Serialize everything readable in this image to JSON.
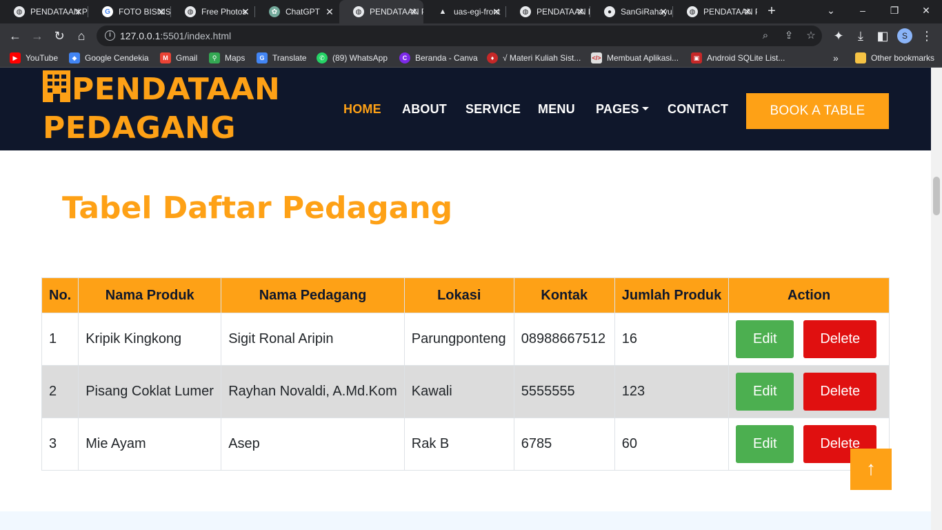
{
  "browser": {
    "tabs": [
      {
        "label": "PENDATAAN PEDAGANG",
        "icon": "globe-icon",
        "active": false
      },
      {
        "label": "FOTO BISNIS",
        "icon": "google-icon",
        "active": false
      },
      {
        "label": "Free Photos",
        "icon": "globe-icon",
        "active": false
      },
      {
        "label": "ChatGPT",
        "icon": "chatgpt-icon",
        "active": false
      },
      {
        "label": "PENDATAAN PEDAGANG",
        "icon": "globe-icon",
        "active": true
      },
      {
        "label": "uas-egi-front",
        "icon": "triangle-icon",
        "active": false
      },
      {
        "label": "PENDATAAN PEDAGANG",
        "icon": "globe-icon",
        "active": false
      },
      {
        "label": "SanGiRahayu",
        "icon": "github-icon",
        "active": false
      },
      {
        "label": "PENDATAAN PEDAGANG",
        "icon": "globe-icon",
        "active": false
      }
    ],
    "address": {
      "host": "127.0.0.1",
      "rest": ":5501/index.html"
    },
    "profile_initial": "S",
    "bookmarks": [
      {
        "label": "YouTube",
        "icon": "youtube-icon",
        "color": "#ff0000"
      },
      {
        "label": "Google Cendekia",
        "icon": "scholar-icon",
        "color": "#4285f4"
      },
      {
        "label": "Gmail",
        "icon": "gmail-icon",
        "color": "#ea4335"
      },
      {
        "label": "Maps",
        "icon": "maps-icon",
        "color": "#34a853"
      },
      {
        "label": "Translate",
        "icon": "translate-icon",
        "color": "#4285f4"
      },
      {
        "label": "(89) WhatsApp",
        "icon": "whatsapp-icon",
        "color": "#25d366"
      },
      {
        "label": "Beranda - Canva",
        "icon": "canva-icon",
        "color": "#7d2ae8"
      },
      {
        "label": "√ Materi Kuliah Sist...",
        "icon": "pin-icon",
        "color": "#c62828"
      },
      {
        "label": "Membuat Aplikasi...",
        "icon": "code-icon",
        "color": "#e0e0e0"
      },
      {
        "label": "Android SQLite List...",
        "icon": "android-icon",
        "color": "#c62828"
      }
    ],
    "overflow_label": "»",
    "other_bookmarks": "Other bookmarks"
  },
  "site": {
    "brand_line1": "PENDATAAN",
    "brand_line2": "PEDAGANG",
    "nav": [
      {
        "label": "HOME",
        "active": true
      },
      {
        "label": "ABOUT",
        "active": false
      },
      {
        "label": "SERVICE",
        "active": false
      },
      {
        "label": "MENU",
        "active": false
      },
      {
        "label": "PAGES",
        "active": false
      },
      {
        "label": "CONTACT",
        "active": false
      }
    ],
    "book_label": "BOOK A TABLE",
    "accent": "#fea116",
    "header_bg": "#0f172b"
  },
  "main": {
    "title": "Tabel Daftar Pedagang",
    "columns": [
      "No.",
      "Nama Produk",
      "Nama Pedagang",
      "Lokasi",
      "Kontak",
      "Jumlah Produk",
      "Action"
    ],
    "rows": [
      {
        "no": "1",
        "produk": "Kripik Kingkong",
        "pedagang": "Sigit Ronal Aripin",
        "lokasi": "Parungponteng",
        "kontak": "08988667512",
        "jumlah": "16"
      },
      {
        "no": "2",
        "produk": "Pisang Coklat Lumer",
        "pedagang": "Rayhan Novaldi, A.Md.Kom",
        "lokasi": "Kawali",
        "kontak": "5555555",
        "jumlah": "123"
      },
      {
        "no": "3",
        "produk": "Mie Ayam",
        "pedagang": "Asep",
        "lokasi": "Rak B",
        "kontak": "6785",
        "jumlah": "60"
      }
    ],
    "edit_label": "Edit",
    "delete_label": "Delete",
    "edit_color": "#4caf50",
    "delete_color": "#e01010"
  }
}
